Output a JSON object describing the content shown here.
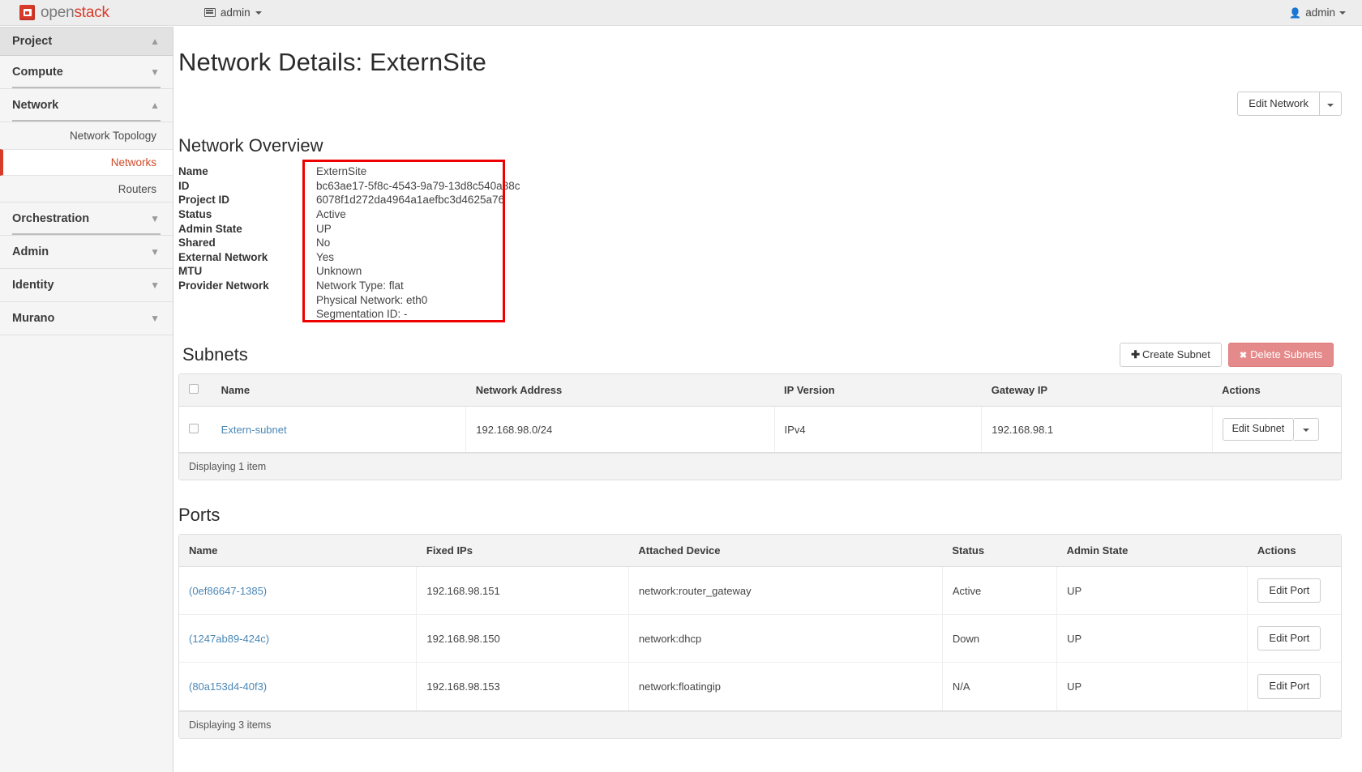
{
  "topbar": {
    "brand_first": "open",
    "brand_second": "stack",
    "context_label": "admin",
    "context_icon": "panel-icon",
    "user_label": "admin",
    "user_icon": "user-icon"
  },
  "sidebar": {
    "panel": {
      "label": "Project",
      "chevron": "chevron-up-icon"
    },
    "groups": [
      {
        "label": "Compute",
        "chevron": "chevron-down-icon",
        "items": []
      },
      {
        "label": "Network",
        "chevron": "chevron-up-icon",
        "items": [
          {
            "label": "Network Topology",
            "active": false
          },
          {
            "label": "Networks",
            "active": true
          },
          {
            "label": "Routers",
            "active": false
          }
        ]
      },
      {
        "label": "Orchestration",
        "chevron": "chevron-down-icon",
        "items": []
      },
      {
        "label": "Admin",
        "chevron": "chevron-down-icon",
        "items": []
      },
      {
        "label": "Identity",
        "chevron": "chevron-down-icon",
        "items": []
      },
      {
        "label": "Murano",
        "chevron": "chevron-down-icon",
        "items": []
      }
    ]
  },
  "page": {
    "title": "Network Details: ExternSite",
    "edit_network_label": "Edit Network",
    "edit_network_caret": "caret-down-icon"
  },
  "overview": {
    "heading": "Network Overview",
    "rows": [
      {
        "label": "Name",
        "value": "ExternSite"
      },
      {
        "label": "ID",
        "value": "bc63ae17-5f8c-4543-9a79-13d8c540a88c"
      },
      {
        "label": "Project ID",
        "value": "6078f1d272da4964a1aefbc3d4625a76"
      },
      {
        "label": "Status",
        "value": "Active"
      },
      {
        "label": "Admin State",
        "value": "UP"
      },
      {
        "label": "Shared",
        "value": "No"
      },
      {
        "label": "External Network",
        "value": "Yes"
      },
      {
        "label": "MTU",
        "value": "Unknown"
      },
      {
        "label": "Provider Network",
        "value": "Network Type: flat"
      }
    ],
    "provider_extra": [
      "Physical Network: eth0",
      "Segmentation ID: -"
    ],
    "highlight_color": "#ef0000"
  },
  "subnets": {
    "heading": "Subnets",
    "create_label": "Create Subnet",
    "create_icon": "plus-icon",
    "delete_label": "Delete Subnets",
    "delete_icon": "times-icon",
    "columns": [
      "",
      "Name",
      "Network Address",
      "IP Version",
      "Gateway IP",
      "Actions"
    ],
    "rows": [
      {
        "name": "Extern-subnet",
        "network_address": "192.168.98.0/24",
        "ip_version": "IPv4",
        "gateway_ip": "192.168.98.1",
        "action_label": "Edit Subnet",
        "action_caret": "caret-down-icon"
      }
    ],
    "footer": "Displaying 1 item"
  },
  "ports": {
    "heading": "Ports",
    "columns": [
      "Name",
      "Fixed IPs",
      "Attached Device",
      "Status",
      "Admin State",
      "Actions"
    ],
    "rows": [
      {
        "name": "(0ef86647-1385)",
        "fixed_ips": "192.168.98.151",
        "attached_device": "network:router_gateway",
        "status": "Active",
        "admin_state": "UP",
        "action_label": "Edit Port"
      },
      {
        "name": "(1247ab89-424c)",
        "fixed_ips": "192.168.98.150",
        "attached_device": "network:dhcp",
        "status": "Down",
        "admin_state": "UP",
        "action_label": "Edit Port"
      },
      {
        "name": "(80a153d4-40f3)",
        "fixed_ips": "192.168.98.153",
        "attached_device": "network:floatingip",
        "status": "N/A",
        "admin_state": "UP",
        "action_label": "Edit Port"
      }
    ],
    "footer": "Displaying 3 items"
  },
  "colors": {
    "brand_red": "#d93b2b",
    "link_blue": "#4b87b5",
    "active_nav": "#cf4a2a",
    "danger": "#e58a8a"
  }
}
